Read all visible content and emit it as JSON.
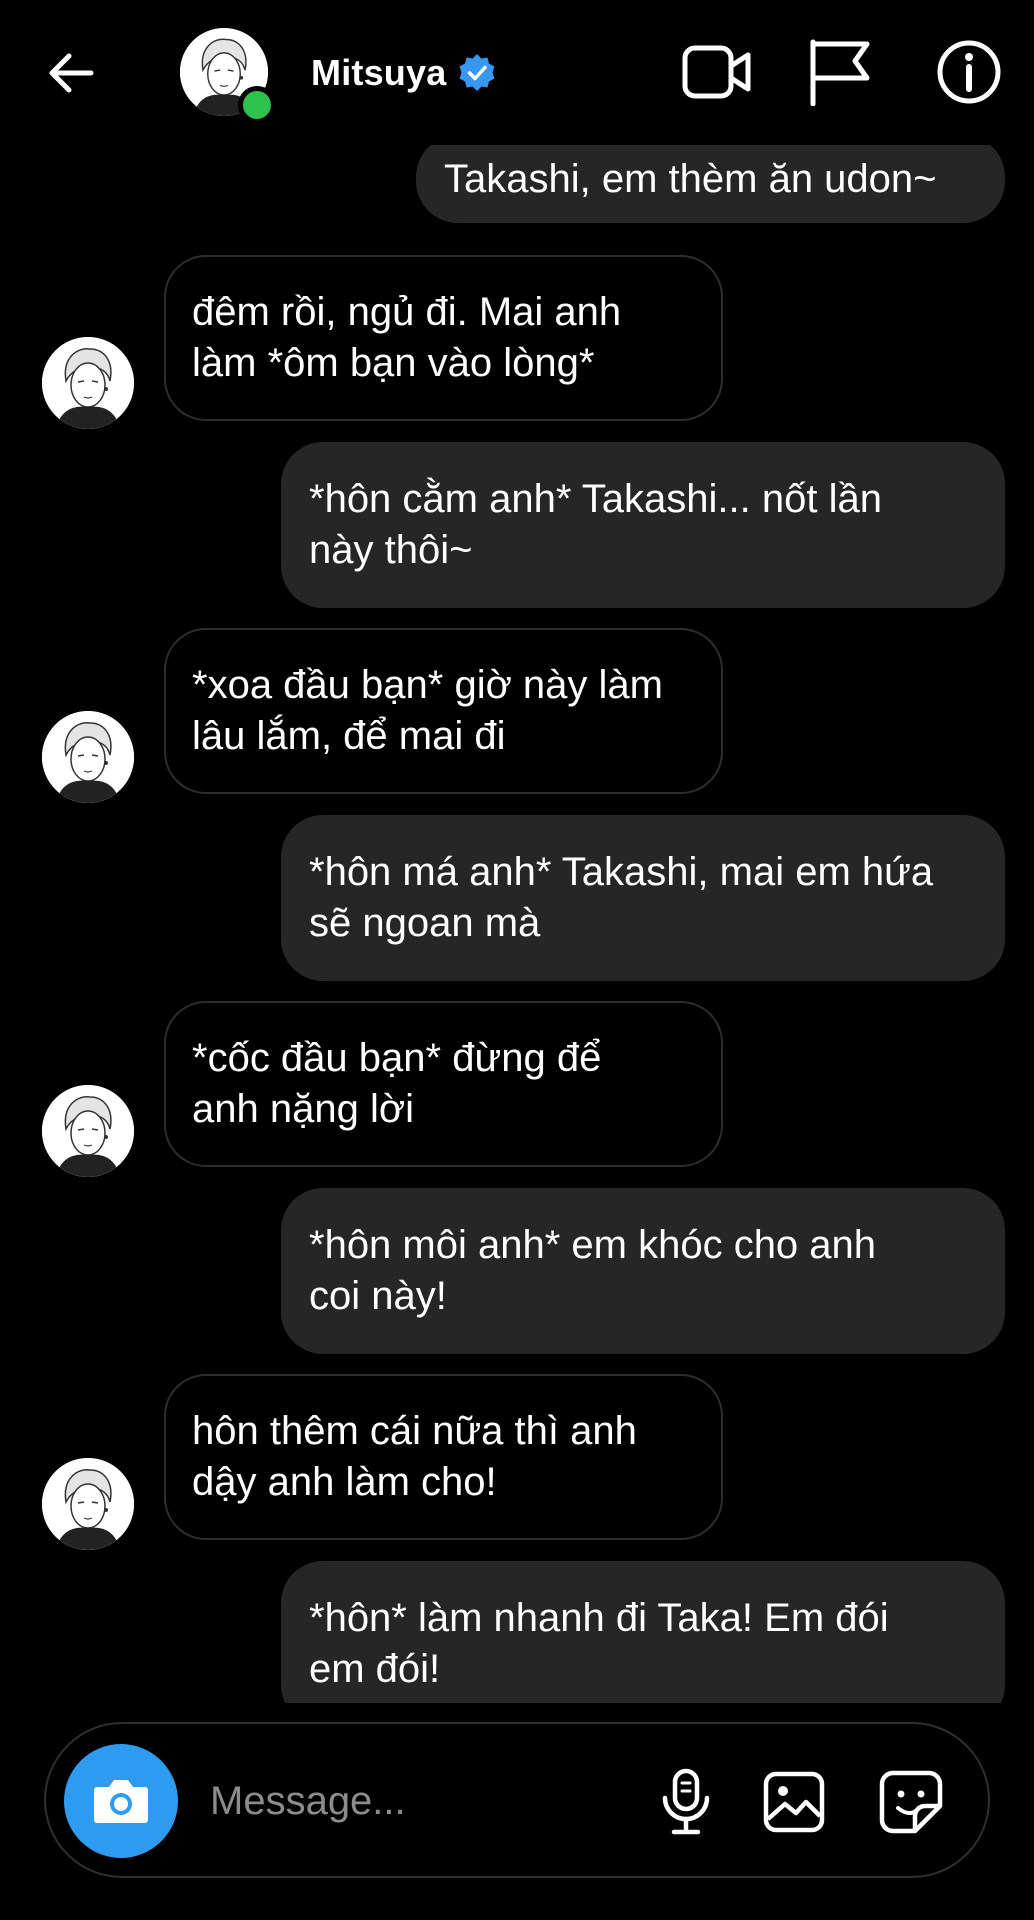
{
  "header": {
    "name": "Mitsuya",
    "back_icon": "arrow-left-icon",
    "verified_icon": "verified-badge-icon",
    "actions": [
      "video-call-icon",
      "flag-icon",
      "info-icon"
    ],
    "online": true
  },
  "messages": [
    {
      "side": "out",
      "text": "Takashi, em thèm ăn udon~"
    },
    {
      "side": "in",
      "text": "đêm rồi, ngủ đi. Mai anh\nlàm *ôm bạn vào lòng*"
    },
    {
      "side": "out",
      "text": "*hôn cằm anh* Takashi... nốt lần\nnày thôi~"
    },
    {
      "side": "in",
      "text": "*xoa đầu bạn* giờ này làm\nlâu lắm, để mai đi"
    },
    {
      "side": "out",
      "text": "*hôn má anh* Takashi, mai em hứa\nsẽ ngoan mà"
    },
    {
      "side": "in",
      "text": "*cốc đầu bạn* đừng để\nanh nặng lời"
    },
    {
      "side": "out",
      "text": "*hôn môi anh* em khóc cho anh\ncoi này!"
    },
    {
      "side": "in",
      "text": "hôn thêm cái nữa thì anh\ndậy anh làm cho!"
    },
    {
      "side": "out",
      "text": "*hôn* làm nhanh đi Taka! Em đói\nem đói!"
    }
  ],
  "composer": {
    "placeholder": "Message...",
    "camera_icon": "camera-icon",
    "mic_icon": "microphone-icon",
    "gallery_icon": "gallery-icon",
    "sticker_icon": "sticker-icon"
  },
  "colors": {
    "background": "#000000",
    "outgoing_bubble": "#262626",
    "incoming_border": "#2d2d2d",
    "camera_button": "#2f9bf0",
    "verified": "#3897f0",
    "online": "#2fc14d"
  }
}
